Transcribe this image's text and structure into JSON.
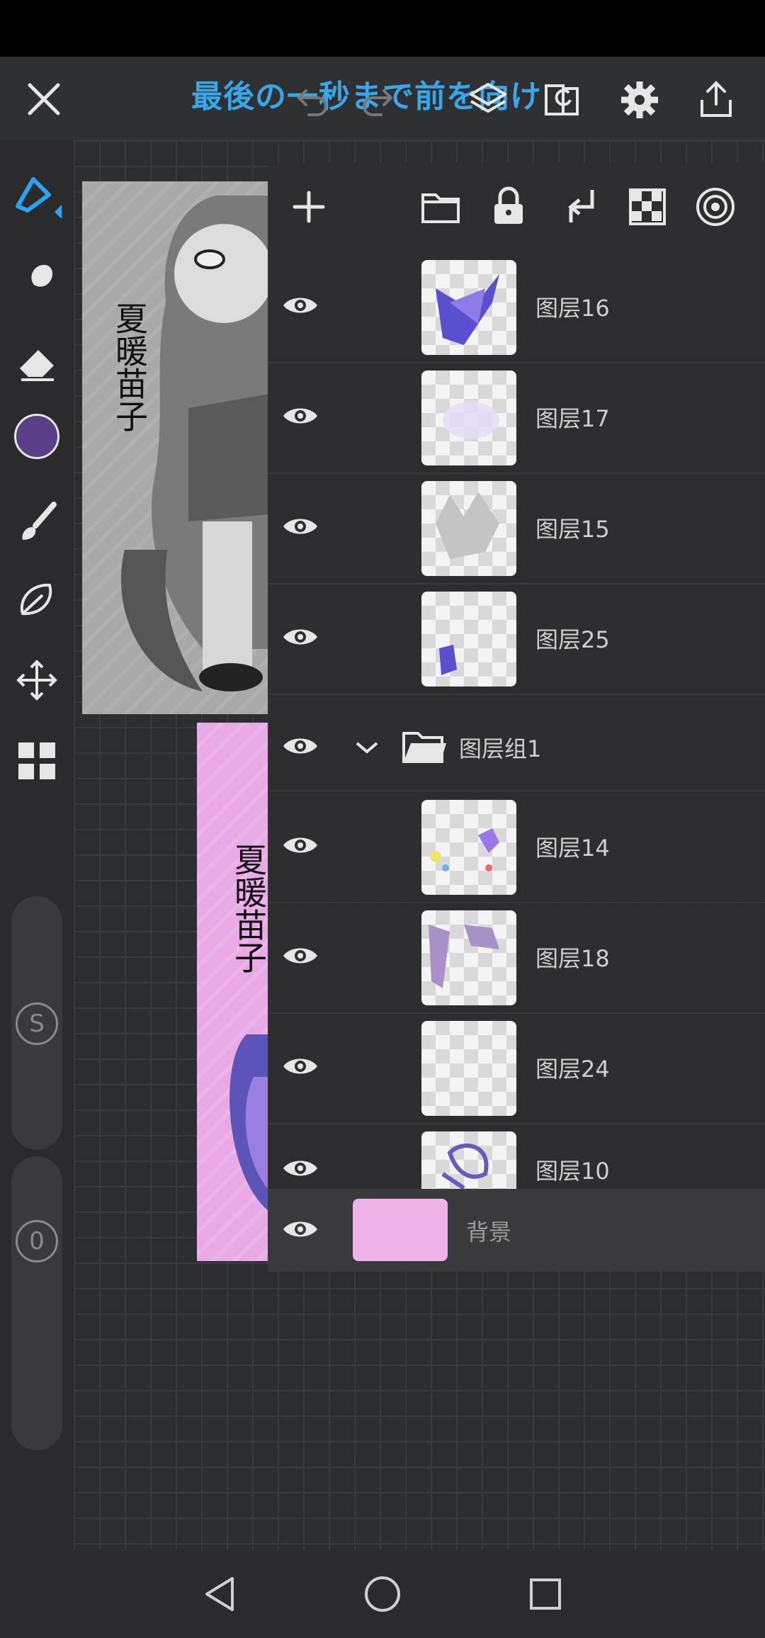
{
  "title": "最後の一秒まで前を向け",
  "toolbar": {
    "icons": [
      "close-icon",
      "undo-icon",
      "redo-icon",
      "layers-icon",
      "transform-icon",
      "settings-icon",
      "share-icon"
    ]
  },
  "tools": {
    "current_color": "#5b3f86",
    "icons": [
      "pen-icon",
      "smudge-icon",
      "eraser-icon",
      "color-swatch",
      "brush-icon",
      "lasso-icon",
      "move-icon",
      "grid-icon"
    ]
  },
  "sliders": {
    "size_label": "S",
    "opacity_label": "0"
  },
  "artwork": {
    "signature": "夏暖苗子"
  },
  "layer_panel": {
    "toolbar_icons": [
      "add-layer-icon",
      "folder-icon",
      "lock-icon",
      "merge-down-icon",
      "transparency-icon",
      "blend-icon"
    ],
    "layers": [
      {
        "name": "图层16"
      },
      {
        "name": "图层17"
      },
      {
        "name": "图层15"
      },
      {
        "name": "图层25"
      }
    ],
    "group": {
      "name": "图层组1"
    },
    "group_layers": [
      {
        "name": "图层14"
      },
      {
        "name": "图层18"
      },
      {
        "name": "图层24"
      },
      {
        "name": "图层10"
      }
    ],
    "background": {
      "name": "背景",
      "color": "#efb3ea"
    }
  }
}
